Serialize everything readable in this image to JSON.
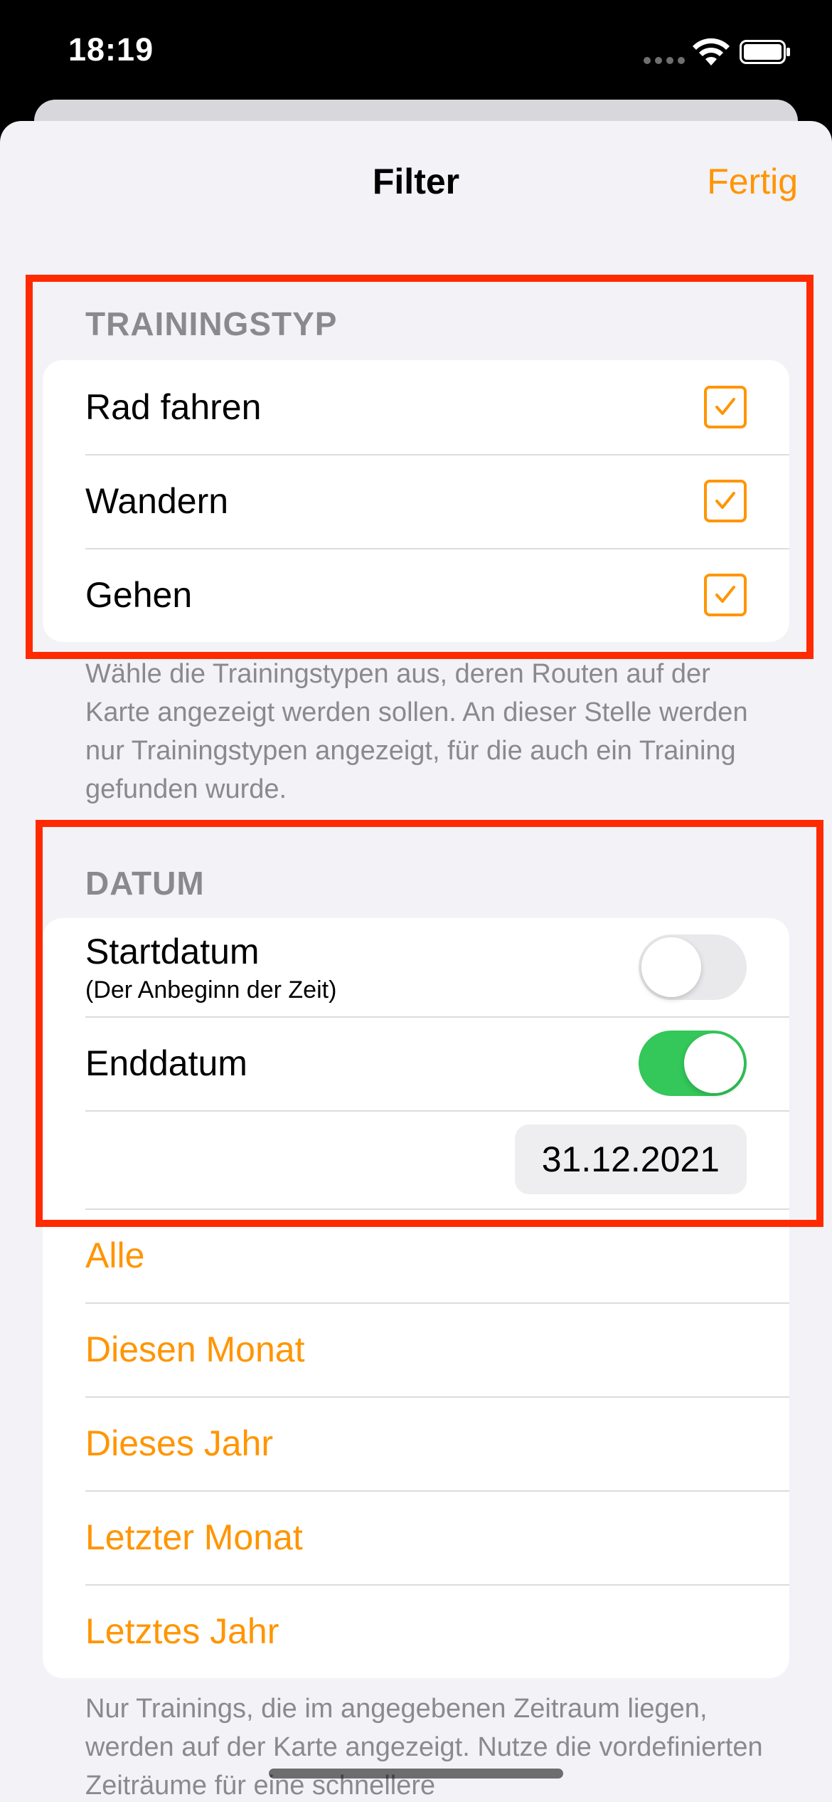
{
  "status_bar": {
    "time": "18:19"
  },
  "nav": {
    "title": "Filter",
    "done_label": "Fertig"
  },
  "training": {
    "header": "TRAININGSTYP",
    "items": [
      {
        "label": "Rad fahren",
        "checked": true
      },
      {
        "label": "Wandern",
        "checked": true
      },
      {
        "label": "Gehen",
        "checked": true
      }
    ],
    "footer": "Wähle die Trainingstypen aus, deren Routen auf der Karte angezeigt werden sollen. An dieser Stelle werden nur Trainingstypen angezeigt, für die auch ein Training gefunden wurde."
  },
  "date": {
    "header": "DATUM",
    "start": {
      "label": "Startdatum",
      "sublabel": "(Der Anbeginn der Zeit)",
      "enabled": false
    },
    "end": {
      "label": "Enddatum",
      "enabled": true,
      "value": "31.12.2021"
    },
    "presets": [
      "Alle",
      "Diesen Monat",
      "Dieses Jahr",
      "Letzter Monat",
      "Letztes Jahr"
    ],
    "footer": "Nur Trainings, die im angegebenen Zeitraum liegen, werden auf der Karte angezeigt. Nutze die vordefinierten Zeiträume für eine schnellere"
  },
  "colors": {
    "accent": "#ff9500",
    "toggle_on": "#34c759",
    "highlight": "#ff2a00",
    "sheet_background": "#f2f2f7"
  },
  "icons": {
    "status": [
      "cellular-dots-icon",
      "wifi-icon",
      "battery-icon"
    ],
    "checkbox": "checkmark-icon"
  }
}
